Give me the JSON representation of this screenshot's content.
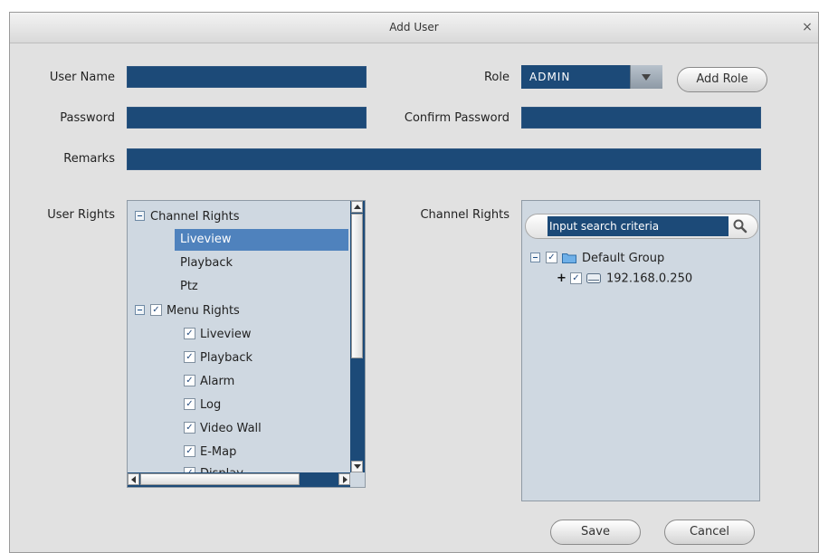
{
  "window": {
    "title": "Add User",
    "close_glyph": "×"
  },
  "form": {
    "user_name_label": "User Name",
    "user_name_value": "",
    "role_label": "Role",
    "role_value": "ADMIN",
    "add_role_label": "Add Role",
    "password_label": "Password",
    "password_value": "",
    "confirm_password_label": "Confirm Password",
    "confirm_password_value": "",
    "remarks_label": "Remarks",
    "remarks_value": ""
  },
  "user_rights": {
    "label": "User Rights",
    "tree": {
      "channel_rights": {
        "label": "Channel Rights",
        "expanded": true,
        "items": [
          {
            "label": "Liveview",
            "selected": true
          },
          {
            "label": "Playback",
            "selected": false
          },
          {
            "label": "Ptz",
            "selected": false
          }
        ]
      },
      "menu_rights": {
        "label": "Menu Rights",
        "checked": true,
        "items": [
          {
            "label": "Liveview",
            "checked": true
          },
          {
            "label": "Playback",
            "checked": true
          },
          {
            "label": "Alarm",
            "checked": true
          },
          {
            "label": "Log",
            "checked": true
          },
          {
            "label": "Video Wall",
            "checked": true
          },
          {
            "label": "E-Map",
            "checked": true
          },
          {
            "label": "Display",
            "checked": true
          }
        ]
      }
    }
  },
  "channel_rights": {
    "label": "Channel Rights",
    "search_placeholder": "Input search criteria",
    "tree": {
      "group": {
        "label": "Default Group",
        "checked": true,
        "icon": "folder-icon"
      },
      "device": {
        "label": "192.168.0.250",
        "checked": true,
        "icon": "device-icon"
      }
    }
  },
  "actions": {
    "save_label": "Save",
    "cancel_label": "Cancel"
  },
  "colors": {
    "field": "#1c4a78",
    "dialog": "#e1e1e1",
    "panel": "#cfd8e1",
    "selection": "#4f82bd"
  }
}
